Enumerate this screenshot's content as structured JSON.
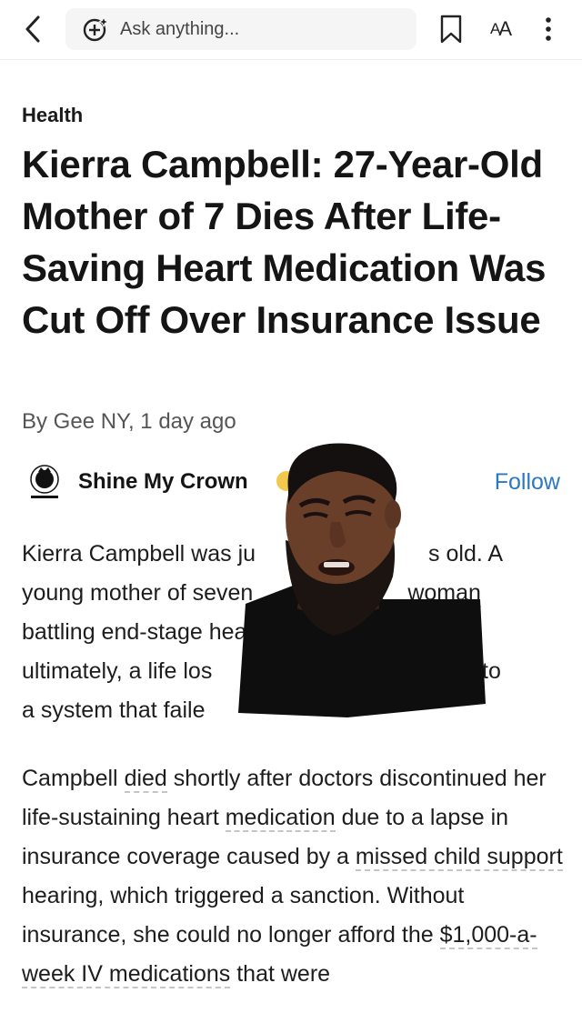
{
  "toolbar": {
    "search_placeholder": "Ask anything...",
    "text_size_label_big": "A",
    "text_size_label_small": "A"
  },
  "article": {
    "category": "Health",
    "headline": "Kierra Campbell: 27-Year-Old Mother of 7 Dies After Life-Saving Heart Medication Was Cut Off Over Insurance Issue",
    "byline_author": "By Gee NY,",
    "byline_time": "1 day ago",
    "publisher_name": "Shine My Crown",
    "follow_label": "Follow",
    "paragraph1": {
      "line1": "Kierra Campbell was ju",
      "line1b": "s old. A",
      "line2": "young mother of seven",
      "line2b": "woman",
      "line3": "battling end-stage hear",
      "line4": "ultimately, a life los",
      "line4b": "out to",
      "line5": "a system that faile"
    },
    "paragraph2": {
      "s1": "Campbell ",
      "u1": "died",
      "s2": " shortly after doctors discontinued her life-sustaining heart ",
      "u2": "medication",
      "s3": " due to a lapse in insurance coverage caused by a ",
      "u3": "missed child support",
      "s4": " hearing, which triggered a sanction. Without insurance, she could no longer afford the ",
      "u4": "$1,000-a-week IV medications",
      "s5": " that were"
    }
  },
  "colors": {
    "accent": "#2b78c2",
    "text": "#1a1a1a",
    "muted": "#555555"
  }
}
